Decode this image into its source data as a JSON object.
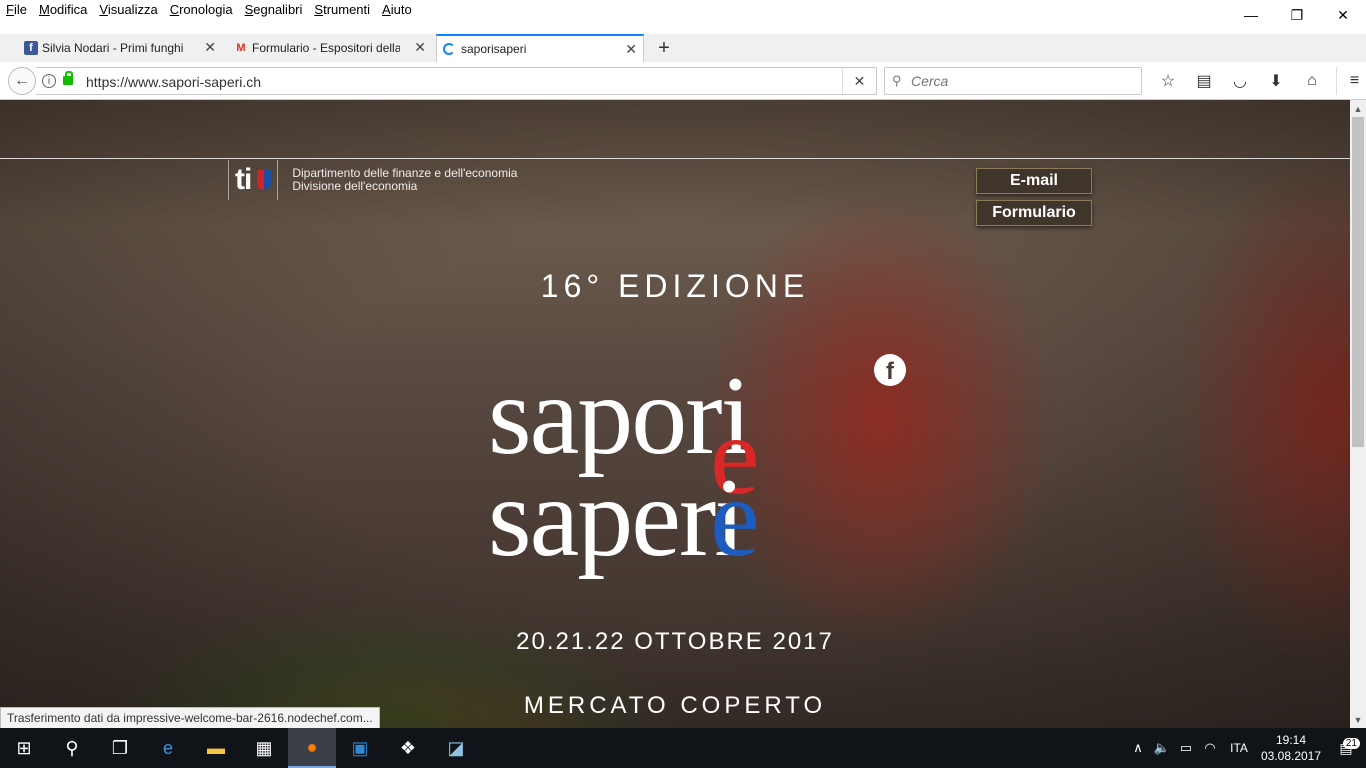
{
  "menubar": {
    "items": [
      "File",
      "Modifica",
      "Visualizza",
      "Cronologia",
      "Segnalibri",
      "Strumenti",
      "Aiuto"
    ]
  },
  "window_controls": {
    "minimize": "—",
    "restore": "❐",
    "close": "✕"
  },
  "tabs": [
    {
      "title": "Silvia Nodari - Primi funghi",
      "favicon": "facebook-icon",
      "favicon_color": "#3b5998"
    },
    {
      "title": "Formulario - Espositori della",
      "favicon": "gmail-icon",
      "favicon_color": "#d93025"
    },
    {
      "title": "saporisaperi",
      "favicon": "loading-icon",
      "favicon_color": "#0a84ff"
    }
  ],
  "navbar": {
    "url": "https://www.sapori-saperi.ch",
    "search_placeholder": "Cerca"
  },
  "page": {
    "department_logo": "ti",
    "department_line1": "Dipartimento delle finanze e dell'economia",
    "department_line2": "Divisione dell'economia",
    "btn_email": "E-mail",
    "btn_formulario": "Formulario",
    "edition": "16° EDIZIONE",
    "wordmark_line1": "sapori",
    "wordmark_line2": "saperi",
    "wordmark_e": "e",
    "dates": "20.21.22 OTTOBRE 2017",
    "venue": "MERCATO COPERTO",
    "status_text": "Trasferimento dati da impressive-welcome-bar-2616.nodechef.com..."
  },
  "taskbar": {
    "lang": "ITA",
    "time": "19:14",
    "date": "03.08.2017",
    "notifications": "21"
  },
  "colors": {
    "accent_tab": "#0a84ff",
    "ticino_red": "#d92626",
    "ticino_blue": "#1d5bbf",
    "taskbar": "#101418"
  }
}
